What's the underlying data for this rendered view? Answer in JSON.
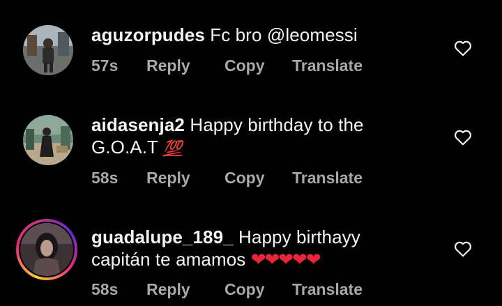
{
  "comments": [
    {
      "username": "aguzorpudes",
      "text": "Fc bro @leomessi",
      "time": "57s",
      "reply": "Reply",
      "copy": "Copy",
      "translate": "Translate"
    },
    {
      "username": "aidasenja2",
      "text": "Happy birthday to the G.O.A.T",
      "emoji": "💯",
      "time": "58s",
      "reply": "Reply",
      "copy": "Copy",
      "translate": "Translate"
    },
    {
      "username": "guadalupe_189_",
      "text": "Happy birthayy capitán te amamos",
      "emoji": "❤❤❤❤❤",
      "time": "58s",
      "reply": "Reply",
      "copy": "Copy",
      "translate": "Translate",
      "has_story_ring": true
    }
  ],
  "colors": {
    "background": "#000000",
    "text": "#f5f5f5",
    "meta": "#a8a8a8",
    "heart_emoji": "#e8253a"
  },
  "icons": {
    "like": "heart-outline-icon"
  }
}
